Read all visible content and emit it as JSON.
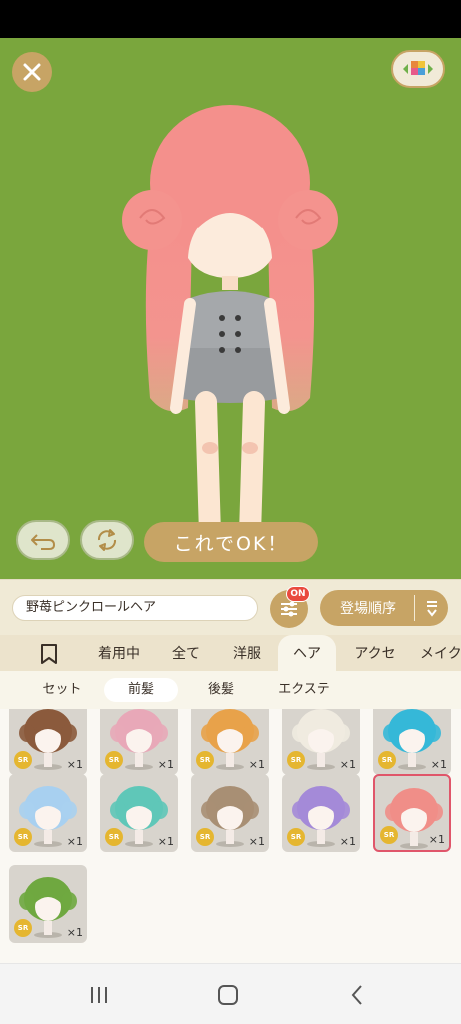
{
  "stage": {
    "background": "#7aa63d",
    "ok_button_label": "これでOK！",
    "close_icon": "close-icon",
    "view_icon": "grid-palette-icon",
    "undo_icon": "undo-icon",
    "rotate_icon": "rotate-icon"
  },
  "toolbar": {
    "item_name": "野苺ピンクロールヘア",
    "filter_badge": "ON",
    "sort_label": "登場順序",
    "filter_icon": "sliders-icon",
    "sort_icon": "sort-order-icon"
  },
  "tabs": [
    {
      "label": "着用中"
    },
    {
      "label": "全て"
    },
    {
      "label": "洋服"
    },
    {
      "label": "ヘア"
    },
    {
      "label": "アクセ"
    },
    {
      "label": "メイク"
    }
  ],
  "active_tab": "ヘア",
  "subtabs": [
    {
      "label": "セット"
    },
    {
      "label": "前髪"
    },
    {
      "label": "後髪"
    },
    {
      "label": "エクステ"
    }
  ],
  "items": [
    {
      "rarity": "SR",
      "qty": "×1",
      "color": "#8b5a3c"
    },
    {
      "rarity": "SR",
      "qty": "×1",
      "color": "#e8a8b8"
    },
    {
      "rarity": "SR",
      "qty": "×1",
      "color": "#e8a24a"
    },
    {
      "rarity": "SR",
      "qty": "×1",
      "color": "#f0ebe0"
    },
    {
      "rarity": "SR",
      "qty": "×1",
      "color": "#35b8d8"
    },
    {
      "rarity": "SR",
      "qty": "×1",
      "color": "#a8d0f0"
    },
    {
      "rarity": "SR",
      "qty": "×1",
      "color": "#5fc7b8"
    },
    {
      "rarity": "SR",
      "qty": "×1",
      "color": "#a88f74"
    },
    {
      "rarity": "SR",
      "qty": "×1",
      "color": "#a48ad8"
    },
    {
      "rarity": "SR",
      "qty": "×1",
      "color": "#f08e88"
    },
    {
      "rarity": "SR",
      "qty": "×1",
      "color": "#6fa840"
    }
  ],
  "selected_item": 9,
  "nav": {
    "recents_icon": "recents-icon",
    "home_icon": "home-icon",
    "back_icon": "back-icon"
  }
}
